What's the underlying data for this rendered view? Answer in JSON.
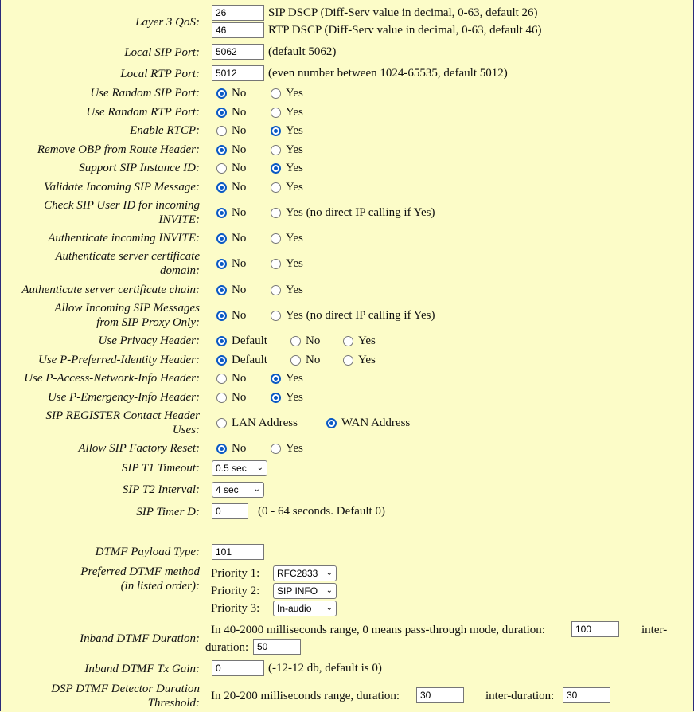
{
  "qos": {
    "label": "Layer 3 QoS:",
    "sip_dscp": "26",
    "sip_dscp_desc": "SIP DSCP (Diff-Serv value in decimal, 0-63, default 26)",
    "rtp_dscp": "46",
    "rtp_dscp_desc": "RTP DSCP (Diff-Serv value in decimal, 0-63, default 46)"
  },
  "local_sip_port": {
    "label": "Local SIP Port:",
    "value": "5062",
    "hint": "(default 5062)"
  },
  "local_rtp_port": {
    "label": "Local RTP Port:",
    "value": "5012",
    "hint": "(even number between 1024-65535, default 5012)"
  },
  "radio_rows": [
    {
      "label": "Use Random SIP Port:",
      "options": [
        "No",
        "Yes"
      ],
      "selected": 0
    },
    {
      "label": "Use Random RTP Port:",
      "options": [
        "No",
        "Yes"
      ],
      "selected": 0
    },
    {
      "label": "Enable RTCP:",
      "options": [
        "No",
        "Yes"
      ],
      "selected": 1
    },
    {
      "label": "Remove OBP from Route Header:",
      "options": [
        "No",
        "Yes"
      ],
      "selected": 0
    },
    {
      "label": "Support SIP Instance ID:",
      "options": [
        "No",
        "Yes"
      ],
      "selected": 1
    },
    {
      "label": "Validate Incoming SIP Message:",
      "options": [
        "No",
        "Yes"
      ],
      "selected": 0
    },
    {
      "label1": "Check SIP User ID for incoming",
      "label2": "INVITE:",
      "options": [
        "No",
        "Yes (no direct IP calling if Yes)"
      ],
      "selected": 0
    },
    {
      "label": "Authenticate incoming INVITE:",
      "options": [
        "No",
        "Yes"
      ],
      "selected": 0
    },
    {
      "label1": "Authenticate server certificate",
      "label2": "domain:",
      "options": [
        "No",
        "Yes"
      ],
      "selected": 0
    },
    {
      "label": "Authenticate server certificate chain:",
      "options": [
        "No",
        "Yes"
      ],
      "selected": 0
    },
    {
      "label1": "Allow Incoming SIP Messages",
      "label2": "from SIP Proxy Only:",
      "options": [
        "No",
        "Yes (no direct IP calling if Yes)"
      ],
      "selected": 0
    },
    {
      "label": "Use Privacy Header:",
      "options": [
        "Default",
        "No",
        "Yes"
      ],
      "selected": 0
    },
    {
      "label": "Use P-Preferred-Identity Header:",
      "options": [
        "Default",
        "No",
        "Yes"
      ],
      "selected": 0
    },
    {
      "label": "Use P-Access-Network-Info Header:",
      "options": [
        "No",
        "Yes"
      ],
      "selected": 1
    },
    {
      "label": "Use P-Emergency-Info Header:",
      "options": [
        "No",
        "Yes"
      ],
      "selected": 1
    },
    {
      "label1": "SIP REGISTER Contact Header",
      "label2": "Uses:",
      "options": [
        "LAN Address",
        "WAN Address"
      ],
      "selected": 1
    },
    {
      "label": "Allow SIP Factory Reset:",
      "options": [
        "No",
        "Yes"
      ],
      "selected": 0
    }
  ],
  "sip_t1": {
    "label": "SIP T1 Timeout:",
    "value": "0.5 sec"
  },
  "sip_t2": {
    "label": "SIP T2 Interval:",
    "value": "4 sec"
  },
  "sip_timer_d": {
    "label": "SIP Timer D:",
    "value": "0",
    "hint": "(0 - 64 seconds. Default 0)"
  },
  "dtmf_payload": {
    "label": "DTMF Payload Type:",
    "value": "101"
  },
  "dtmf_method": {
    "label1": "Preferred DTMF method",
    "label2": "(in listed order):",
    "priorities": [
      {
        "label": "Priority 1:",
        "value": "RFC2833"
      },
      {
        "label": "Priority 2:",
        "value": "SIP INFO"
      },
      {
        "label": "Priority 3:",
        "value": "In-audio"
      }
    ]
  },
  "inband_duration": {
    "label": "Inband DTMF Duration:",
    "text1": "In 40-2000 milliseconds range, 0 means pass-through mode, duration:",
    "duration": "100",
    "inter_a": "inter-",
    "inter_b": "duration:",
    "inter_duration": "50"
  },
  "inband_gain": {
    "label": "Inband DTMF Tx Gain:",
    "value": "0",
    "hint": "(-12-12 db, default is 0)"
  },
  "dsp_threshold": {
    "label1": "DSP DTMF Detector Duration",
    "label2": "Threshold:",
    "text1": "In 20-200 milliseconds range, duration:",
    "duration": "30",
    "inter_text": "inter-duration:",
    "inter_duration": "30"
  }
}
